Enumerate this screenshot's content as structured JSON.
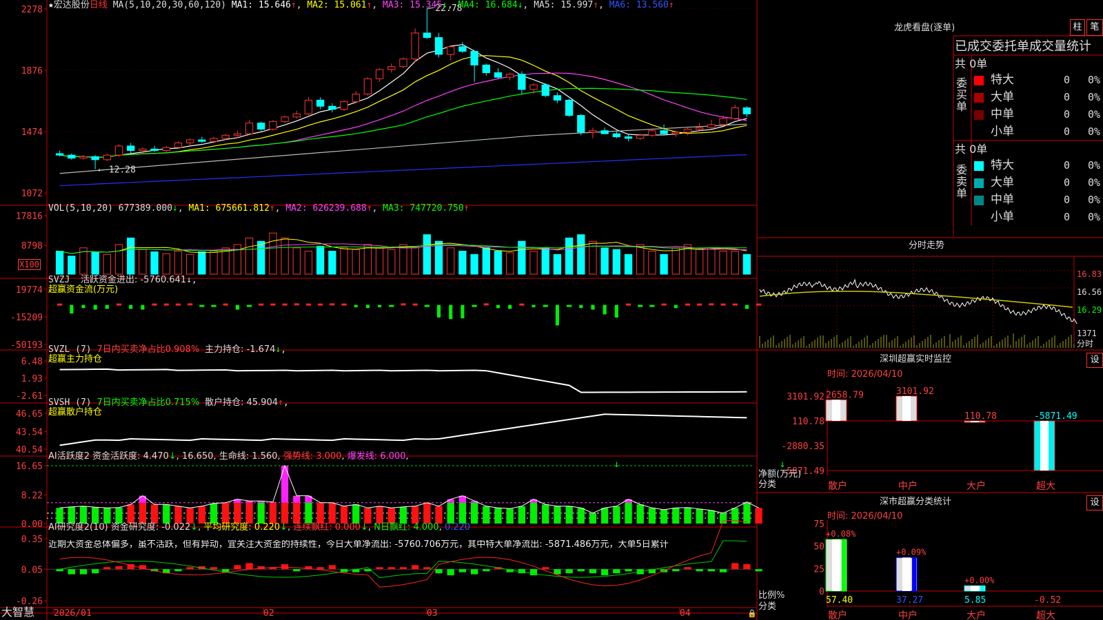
{
  "stock": {
    "star": "★",
    "name": "宏达股份",
    "period": "日线"
  },
  "main": {
    "ma_label": "MA(5,10,20,30,60,120)",
    "ma_values": [
      {
        "label": "MA1: 15.646",
        "arrow": "↑",
        "color": "#ffffff",
        "arrow_color": "#ff3333"
      },
      {
        "label": "MA2: 15.061",
        "arrow": "↑",
        "color": "#ffff00",
        "arrow_color": "#ff3333"
      },
      {
        "label": "MA3: 15.345",
        "arrow": "↓",
        "color": "#ff44ff",
        "arrow_color": "#00ff00"
      },
      {
        "label": "MA4: 16.684",
        "arrow": "↓",
        "color": "#00ff00",
        "arrow_color": "#00ff00"
      },
      {
        "label": "MA5: 15.997",
        "arrow": "↑",
        "color": "#dddddd",
        "arrow_color": "#ff3333"
      },
      {
        "label": "MA6: 13.560",
        "arrow": "↑",
        "color": "#3355ff",
        "arrow_color": "#ff3333"
      }
    ],
    "y_ticks": [
      "2278",
      "1876",
      "1474",
      "1072"
    ],
    "high_label": "22.78",
    "low_label": "12.28"
  },
  "vol": {
    "title": "VOL(5,10,20)",
    "value": "677389.000",
    "value_arrow": "↓",
    "ma": [
      {
        "label": "MA1: 675661.812",
        "arrow": "↑",
        "color": "#ffff00",
        "arrow_color": "#ff3333"
      },
      {
        "label": "MA2: 626239.688",
        "arrow": "↑",
        "color": "#ff44ff",
        "arrow_color": "#ff3333"
      },
      {
        "label": "MA3: 747720.750",
        "arrow": "↑",
        "color": "#00ff00",
        "arrow_color": "#ff3333"
      }
    ],
    "y_ticks": [
      "17816",
      "8798"
    ],
    "unit": "X100"
  },
  "svzj": {
    "title": "SVZJ",
    "sub": "活跃资金进出: -5760.641",
    "arrow": "↓",
    "label2": "超赢资金流(万元)",
    "y_ticks": [
      "19774",
      "-15209",
      "-50193"
    ]
  },
  "svzl": {
    "title": "SVZL (7)",
    "green": "7日内买卖净占比0.908%",
    "main": "主力持仓: -1.674",
    "arrow": "↓",
    "label2": "超赢主力持仓",
    "y_ticks": [
      "6.48",
      "1.93",
      "-2.61"
    ]
  },
  "svsh": {
    "title": "SVSH (7)",
    "green": "7日内买卖净占比0.715%",
    "main": "散户持仓: 45.904",
    "arrow": "↑",
    "label2": "超赢散户持仓",
    "y_ticks": [
      "46.65",
      "43.54",
      "40.54"
    ]
  },
  "ai1": {
    "title": "AI活跃度2",
    "a": "资金活跃度: 4.470",
    "b": "16.650",
    "c": "生命线: 1.560",
    "d": "强势线: 3.000",
    "e": "爆发线: 6.000",
    "y_ticks": [
      "16.65",
      "8.22",
      "0.00"
    ]
  },
  "ai2": {
    "title": "AI研究度2(10)",
    "a": "资金研究度: -0.022",
    "b": "平均研究度: 0.220",
    "c": "连续飘红: 0.000",
    "d": "N日飘红: 4.000",
    "e": "0.220",
    "text": "近期大资金总体偏多，虽不活跃，但有异动，宜关注大资金的持续性，今日大单净流出: -5760.706万元，其中特大单净流出: -5871.486万元，大单5日累计",
    "y_ticks": [
      "0.35",
      "0.05",
      "-0.26"
    ]
  },
  "x_axis": {
    "ticks": [
      "2026/01",
      "02",
      "03",
      "04"
    ],
    "brand": "大智慧"
  },
  "lhb": {
    "title": "龙虎看盘(逐单)",
    "btn1": "柱",
    "btn2": "笔",
    "header": "已成交委托单成交量统计",
    "buy": {
      "side": "委买单",
      "total": "共 0单",
      "rows": [
        {
          "name": "特大",
          "val": "0",
          "pct": "0%",
          "color": "#ff0000"
        },
        {
          "name": "大单",
          "val": "0",
          "pct": "0%",
          "color": "#aa0000"
        },
        {
          "name": "中单",
          "val": "0",
          "pct": "0%",
          "color": "#770000"
        },
        {
          "name": "小单",
          "val": "0",
          "pct": "0%",
          "color": "#000000"
        }
      ]
    },
    "sell": {
      "side": "委卖单",
      "total": "共 0单",
      "rows": [
        {
          "name": "特大",
          "val": "0",
          "pct": "0%",
          "color": "#00ffff"
        },
        {
          "name": "大单",
          "val": "0",
          "pct": "0%",
          "color": "#00aaaa"
        },
        {
          "name": "中单",
          "val": "0",
          "pct": "0%",
          "color": "#008888"
        },
        {
          "name": "小单",
          "val": "0",
          "pct": "0%",
          "color": "#000000"
        }
      ]
    }
  },
  "intraday": {
    "title": "分时走势",
    "y_ticks": [
      "16.83",
      "16.56",
      "16.29"
    ],
    "vol_tick": "1371",
    "vol_label": "分时"
  },
  "sz_monitor": {
    "title": "深圳超赢实时监控",
    "btn": "设",
    "date": "时间: 2026/04/10",
    "y_ticks": [
      "3101.92",
      "110.78",
      "-2880.35",
      "-5871.49"
    ],
    "ylabel": "净额(万元)",
    "xlabel": "分类",
    "bars": [
      {
        "cat": "散户",
        "value": 2658.79,
        "label": "2658.79"
      },
      {
        "cat": "中户",
        "value": 3101.92,
        "label": "3101.92"
      },
      {
        "cat": "大户",
        "value": 110.78,
        "label": "110.78"
      },
      {
        "cat": "超大",
        "value": -5871.49,
        "label": "-5871.49"
      }
    ]
  },
  "sz_class": {
    "title": "深市超赢分类统计",
    "btn": "设",
    "date": "时间: 2026/04/10",
    "y_ticks": [
      "75",
      "50",
      "25",
      "0"
    ],
    "ylabel": "比例%",
    "xlabel": "分类",
    "bars": [
      {
        "cat": "散户",
        "value": 57.4,
        "top": "+0.08%",
        "bottom": "57.40"
      },
      {
        "cat": "中户",
        "value": 37.27,
        "top": "+0.09%",
        "bottom": "37.27"
      },
      {
        "cat": "大户",
        "value": 5.85,
        "top": "+0.00%",
        "bottom": "5.85"
      },
      {
        "cat": "超大",
        "value": -0.52,
        "top": "",
        "bottom": "-0.52"
      }
    ]
  },
  "chart_data": {
    "type": "candlestick",
    "candles": [
      [
        13.3,
        13.5,
        13.1,
        13.2
      ],
      [
        13.2,
        13.3,
        12.9,
        13.0
      ],
      [
        13.0,
        13.2,
        12.9,
        13.1
      ],
      [
        13.1,
        13.2,
        12.28,
        12.9
      ],
      [
        12.9,
        13.3,
        12.8,
        13.2
      ],
      [
        13.2,
        13.9,
        13.1,
        13.8
      ],
      [
        13.8,
        14.0,
        13.3,
        13.5
      ],
      [
        13.5,
        13.7,
        13.3,
        13.6
      ],
      [
        13.6,
        13.8,
        13.4,
        13.5
      ],
      [
        13.5,
        13.8,
        13.4,
        13.7
      ],
      [
        13.7,
        14.1,
        13.6,
        14.0
      ],
      [
        14.0,
        14.3,
        13.8,
        14.2
      ],
      [
        14.2,
        14.4,
        14.0,
        14.1
      ],
      [
        14.1,
        14.4,
        14.0,
        14.3
      ],
      [
        14.3,
        14.6,
        14.2,
        14.5
      ],
      [
        14.5,
        14.8,
        14.3,
        14.6
      ],
      [
        14.6,
        15.5,
        14.5,
        15.3
      ],
      [
        15.3,
        15.4,
        14.8,
        14.9
      ],
      [
        14.9,
        15.5,
        14.8,
        15.4
      ],
      [
        15.4,
        15.8,
        15.3,
        15.7
      ],
      [
        15.7,
        16.1,
        15.6,
        15.9
      ],
      [
        15.9,
        17.0,
        15.8,
        16.8
      ],
      [
        16.8,
        17.0,
        16.2,
        16.4
      ],
      [
        16.4,
        16.6,
        16.0,
        16.2
      ],
      [
        16.2,
        16.8,
        16.1,
        16.7
      ],
      [
        16.7,
        17.4,
        16.6,
        17.2
      ],
      [
        17.2,
        18.3,
        17.1,
        18.2
      ],
      [
        18.2,
        18.9,
        18.0,
        18.8
      ],
      [
        18.8,
        19.2,
        18.6,
        19.0
      ],
      [
        19.0,
        19.6,
        18.9,
        19.5
      ],
      [
        19.5,
        21.5,
        19.3,
        21.2
      ],
      [
        21.2,
        22.78,
        20.8,
        20.9
      ],
      [
        20.9,
        21.2,
        19.6,
        19.8
      ],
      [
        19.8,
        20.4,
        19.4,
        20.3
      ],
      [
        20.3,
        20.6,
        19.9,
        20.0
      ],
      [
        20.0,
        20.0,
        18.0,
        19.1
      ],
      [
        19.1,
        19.2,
        18.4,
        18.6
      ],
      [
        18.6,
        18.9,
        18.2,
        18.3
      ],
      [
        18.3,
        18.6,
        18.1,
        18.5
      ],
      [
        18.5,
        18.7,
        17.2,
        17.5
      ],
      [
        17.5,
        17.9,
        17.2,
        17.8
      ],
      [
        17.8,
        17.9,
        17.0,
        17.1
      ],
      [
        17.1,
        17.3,
        16.6,
        16.8
      ],
      [
        16.8,
        16.9,
        15.7,
        15.8
      ],
      [
        15.8,
        15.9,
        14.5,
        14.7
      ],
      [
        14.7,
        15.0,
        14.3,
        14.8
      ],
      [
        14.8,
        15.0,
        14.6,
        14.6
      ],
      [
        14.6,
        14.8,
        14.3,
        14.4
      ],
      [
        14.4,
        14.6,
        14.1,
        14.3
      ],
      [
        14.3,
        14.6,
        14.2,
        14.5
      ],
      [
        14.5,
        14.9,
        14.4,
        14.8
      ],
      [
        14.8,
        15.2,
        14.5,
        14.6
      ],
      [
        14.6,
        14.8,
        14.4,
        14.7
      ],
      [
        14.7,
        15.0,
        14.5,
        14.9
      ],
      [
        14.9,
        15.3,
        14.8,
        15.0
      ],
      [
        15.0,
        15.5,
        14.9,
        15.2
      ],
      [
        15.2,
        15.8,
        15.1,
        15.6
      ],
      [
        15.6,
        16.5,
        15.5,
        16.3
      ],
      [
        16.3,
        16.4,
        15.7,
        15.9
      ]
    ],
    "volumes": [
      7,
      5.5,
      8,
      6.8,
      6,
      9,
      11,
      7.5,
      6.8,
      6.2,
      7,
      6,
      6.8,
      7,
      8,
      9,
      11,
      10,
      12.5,
      11,
      8,
      7,
      8.5,
      7,
      8,
      7.5,
      9,
      8,
      7.5,
      9,
      8,
      12,
      10,
      8,
      7,
      6,
      8,
      7,
      6.5,
      10,
      7,
      8,
      6,
      11,
      12,
      10,
      8,
      7.5,
      6,
      9,
      7,
      6,
      8,
      9,
      7.5,
      8,
      7,
      7,
      6
    ],
    "svzj": [
      0.8,
      -11,
      -4,
      -6,
      -5,
      0.5,
      -5,
      -6,
      1,
      1,
      0,
      2,
      -2,
      -1,
      0.5,
      -6,
      -2,
      0,
      0.5,
      1,
      2,
      1.5,
      0,
      2,
      0.2,
      -3,
      -4,
      -3,
      -2,
      2,
      1,
      -1,
      -16,
      -18,
      -17,
      -1,
      2,
      -4,
      -5,
      1,
      -3,
      -2,
      -26,
      -1,
      -4,
      -6,
      -12,
      -16,
      1,
      -2,
      -1,
      1,
      -4,
      1,
      0.5,
      2,
      0.5,
      1,
      -5,
      1
    ],
    "ai_activity": [
      4.5,
      4.8,
      5,
      4.7,
      4.5,
      4.6,
      5.5,
      8,
      5.5,
      5.5,
      5,
      4.5,
      5,
      5.8,
      6,
      7,
      6.5,
      6.5,
      6.2,
      16.65,
      8,
      8,
      6,
      6,
      5,
      5.5,
      4.5,
      5,
      4.5,
      4.8,
      5,
      6,
      5,
      7,
      8,
      6.5,
      5,
      4.5,
      4.3,
      5,
      7,
      5.5,
      5,
      5,
      4.5,
      3,
      4.5,
      5,
      7,
      5.5,
      4.5,
      4,
      4.5,
      4.6,
      4.2,
      3.8,
      3,
      4.5,
      6.2,
      4.5
    ],
    "ai_research": [
      -0.02,
      -0.05,
      -0.05,
      -0.04,
      0.01,
      0.03,
      0.05,
      0.04,
      -0.02,
      -0.04,
      -0.01,
      0.02,
      0.03,
      0.02,
      -0.03,
      0.04,
      0.06,
      0.03,
      0.02,
      0.05,
      -0.02,
      0.03,
      0.02,
      0.04,
      -0.03,
      -0.03,
      -0.02,
      0.01,
      0.01,
      0.02,
      0.04,
      0.02,
      -0.04,
      -0.06,
      -0.03,
      -0.05,
      -0.02,
      0.02,
      -0.03,
      -0.04,
      -0.06,
      0.01,
      -0.05,
      -0.04,
      -0.02,
      -0.04,
      -0.06,
      -0.04,
      -0.02,
      -0.05,
      -0.04,
      -0.03,
      -0.02,
      0.02,
      -0.01,
      -0.02,
      -0.03,
      0.06,
      0.05,
      -0.02
    ]
  }
}
